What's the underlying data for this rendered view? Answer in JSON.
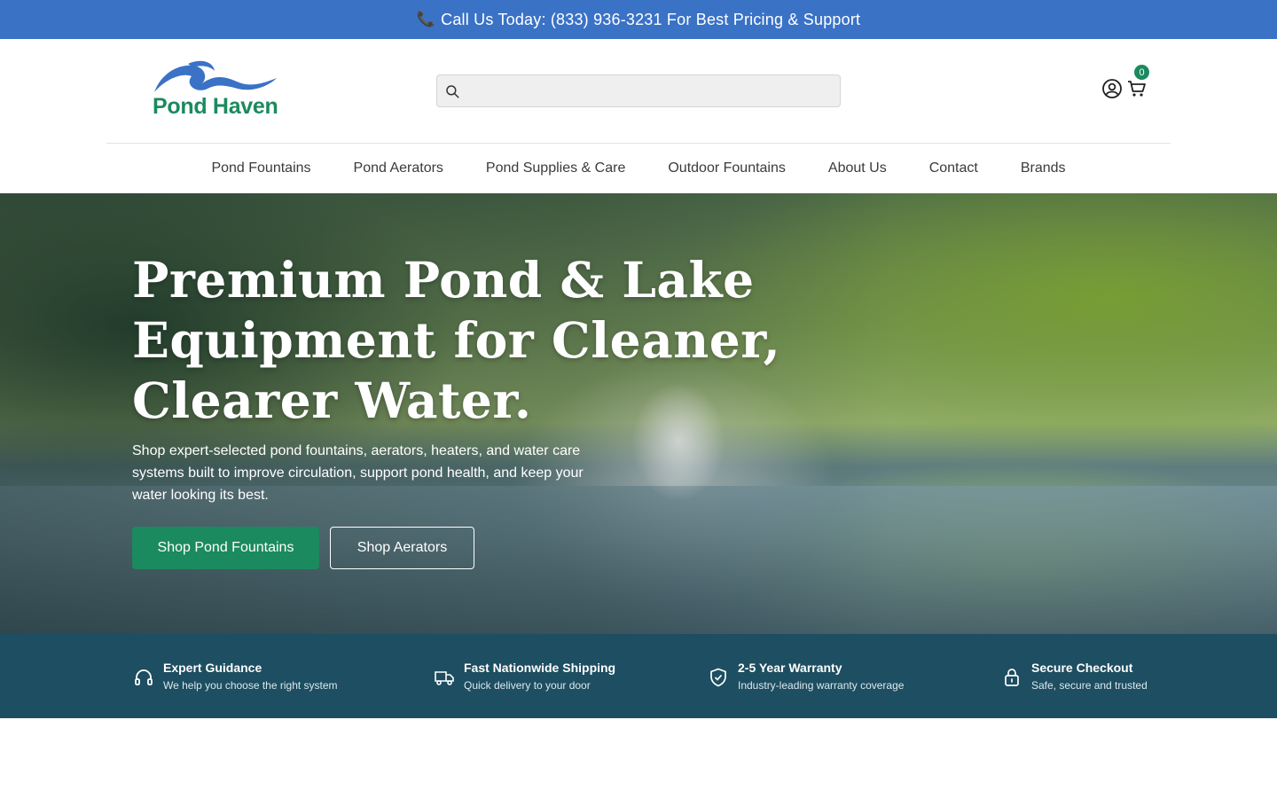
{
  "announcement": {
    "icon": "phone-icon",
    "text": "Call Us Today: (833) 936-3231 For Best Pricing & Support"
  },
  "header": {
    "logo_text": "Pond Haven",
    "logo_colors": {
      "wave": "#3a72c6",
      "text": "#1b8a5e"
    },
    "search": {
      "placeholder": "",
      "value": "",
      "icon": "search-icon"
    },
    "account_icon": "user-circle-icon",
    "cart": {
      "icon": "cart-icon",
      "count": "0"
    }
  },
  "nav": {
    "items": [
      {
        "label": "Pond Fountains"
      },
      {
        "label": "Pond Aerators"
      },
      {
        "label": "Pond Supplies & Care"
      },
      {
        "label": "Outdoor Fountains"
      },
      {
        "label": "About Us"
      },
      {
        "label": "Contact"
      },
      {
        "label": "Brands"
      }
    ]
  },
  "hero": {
    "title": "Premium Pond & Lake Equipment for Cleaner, Clearer Water.",
    "subtitle": "Shop expert-selected pond fountains, aerators, heaters, and water care systems built to improve circulation, support pond health, and keep your water looking its best.",
    "primary_button": "Shop Pond Fountains",
    "secondary_button": "Shop Aerators"
  },
  "features": [
    {
      "icon": "headphones-icon",
      "title": "Expert Guidance",
      "text": "We help you choose the right system"
    },
    {
      "icon": "truck-icon",
      "title": "Fast Nationwide Shipping",
      "text": "Quick delivery to your door"
    },
    {
      "icon": "shield-check-icon",
      "title": "2-5 Year Warranty",
      "text": "Industry-leading warranty coverage"
    },
    {
      "icon": "lock-icon",
      "title": "Secure Checkout",
      "text": "Safe, secure and trusted"
    }
  ],
  "colors": {
    "announcement_bg": "#3a72c6",
    "brand_green": "#1b8a5e",
    "feature_bar_bg": "#1d4e61"
  }
}
